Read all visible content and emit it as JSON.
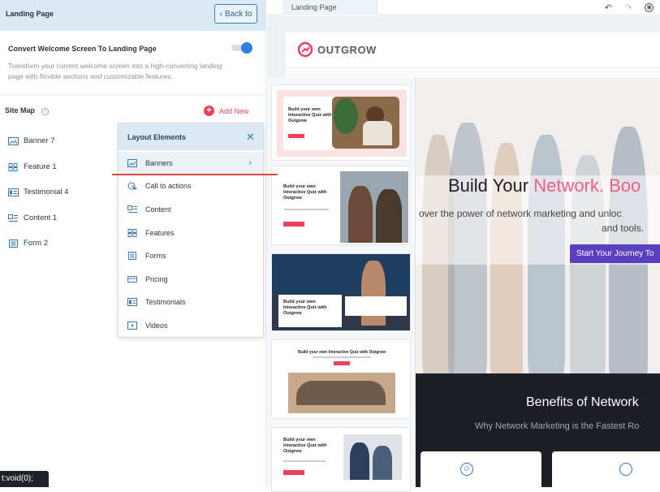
{
  "left_panel": {
    "title": "Landing Page",
    "back_label": "Back to",
    "convert_title": "Convert Welcome Screen To Landing Page",
    "convert_desc": "Transform your current welcome screen into a high-converting landing page with flexible sections and customizable features.",
    "toggle_on": true,
    "sitemap_label": "Site Map",
    "add_new_label": "Add New",
    "sitemap_items": [
      {
        "label": "Banner 7",
        "icon": "banner-icon"
      },
      {
        "label": "Feature 1",
        "icon": "feature-grid-icon"
      },
      {
        "label": "Testimonial 4",
        "icon": "testimonial-icon"
      },
      {
        "label": "Content 1",
        "icon": "content-icon"
      },
      {
        "label": "Form 2",
        "icon": "form-icon"
      }
    ]
  },
  "dropdown": {
    "title": "Layout Elements",
    "items": [
      {
        "label": "Banners",
        "icon": "image-icon",
        "active": true
      },
      {
        "label": "Call to actions",
        "icon": "cursor-click-icon"
      },
      {
        "label": "Content",
        "icon": "content-icon"
      },
      {
        "label": "Features",
        "icon": "feature-grid-icon"
      },
      {
        "label": "Forms",
        "icon": "form-icon"
      },
      {
        "label": "Pricing",
        "icon": "pricing-card-icon"
      },
      {
        "label": "Testimonials",
        "icon": "testimonial-icon"
      },
      {
        "label": "Videos",
        "icon": "video-icon"
      }
    ]
  },
  "templates": [
    {
      "heading": "Build your own Interactive Quiz with Outgrow"
    },
    {
      "heading": "Build your own Interactive Quiz with Outgrow"
    },
    {
      "heading": "Build your own Interactive Quiz with Outgrow"
    },
    {
      "heading": "Build your own Interactive Quiz with Outgrow"
    },
    {
      "heading": "Build your own Interactive Quiz with Outgrow"
    }
  ],
  "editor": {
    "tab_label": "Landing Page",
    "logo_text": "OUTGROW",
    "hero_title_a": "Build Your ",
    "hero_title_b": "Network. Boo",
    "hero_sub1": "over the power of network marketing and unloc",
    "hero_sub2": "and tools.",
    "cta_label": "Start Your Journey To",
    "benefits_title": "Benefits of Network",
    "benefits_sub": "Why Network Marketing is the Fastest Ro"
  },
  "tooltip": "t:void(0);",
  "colors": {
    "accent_red": "#ee3f59",
    "toggle_blue": "#2f7de0",
    "hero_pink": "#f25d87",
    "cta_purple": "#5a3fc0",
    "header_blue": "#dbe9f5"
  }
}
